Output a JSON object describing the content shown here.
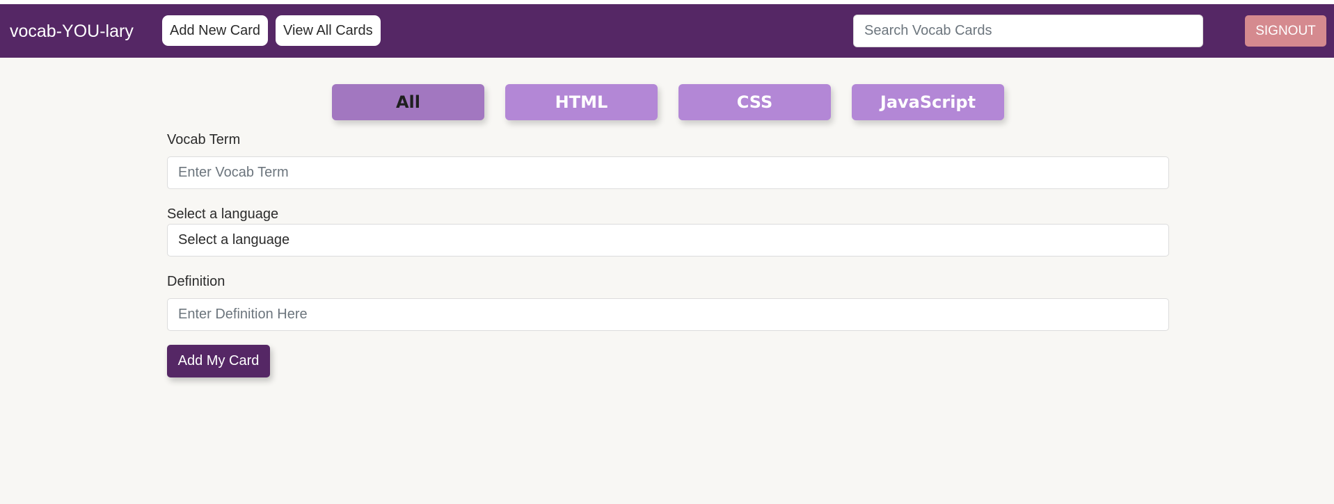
{
  "nav": {
    "brand": "vocab-YOU-lary",
    "add_new_card": "Add New Card",
    "view_all_cards": "View All Cards",
    "search_placeholder": "Search Vocab Cards",
    "signout": "SIGNOUT"
  },
  "filters": {
    "all": "All",
    "html": "HTML",
    "css": "CSS",
    "javascript": "JavaScript",
    "active": "All"
  },
  "form": {
    "term_label": "Vocab Term",
    "term_placeholder": "Enter Vocab Term",
    "language_label": "Select a language",
    "language_selected": "Select a language",
    "definition_label": "Definition",
    "definition_placeholder": "Enter Definition Here",
    "submit_label": "Add My Card"
  },
  "colors": {
    "navbar": "#552765",
    "filter_button": "#b387d6",
    "filter_active": "#a277c0",
    "signout": "#d58a8f",
    "background": "#f8f7f4"
  }
}
